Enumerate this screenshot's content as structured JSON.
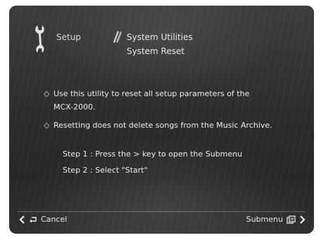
{
  "header": {
    "setup_label": "Setup",
    "utilities_label": "System Utilities",
    "page_title": "System Reset"
  },
  "body": {
    "bullets": [
      "Use this utility to reset all setup parameters of the\nMCX-2000.",
      "Resetting does not delete songs from the Music Archive."
    ],
    "steps": [
      "Step 1 : Press the > key to open the Submenu",
      "Step 2 : Select \"Start\""
    ]
  },
  "footer": {
    "cancel_label": "Cancel",
    "submenu_label": "Submenu"
  },
  "icons": {
    "setup": "wrench-icon",
    "utilities": "tools-icon",
    "back": "chevron-left-icon",
    "return": "return-arrow-icon",
    "submenu": "submenu-icon",
    "forward": "chevron-right-icon",
    "bullet": "diamond-bullet-icon"
  }
}
